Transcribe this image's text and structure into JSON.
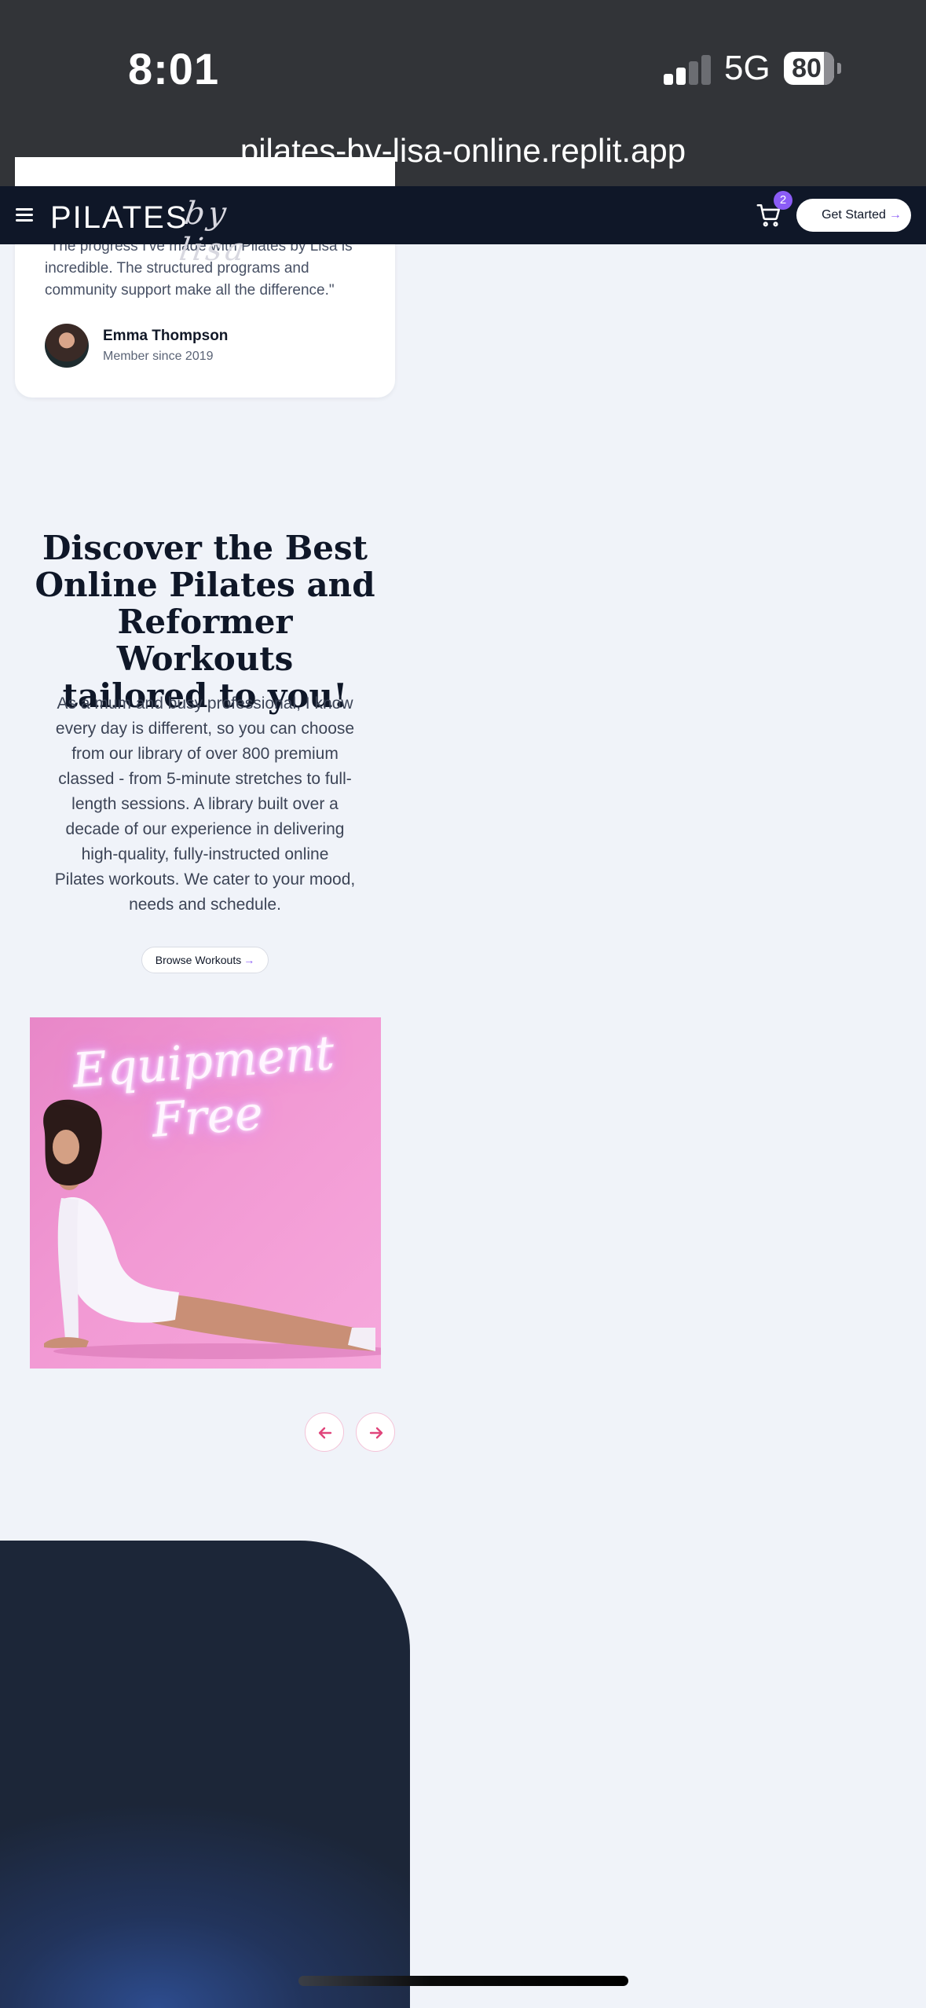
{
  "status_bar": {
    "time": "8:01",
    "network": "5G",
    "battery": "80",
    "url": "pilates-by-lisa-online.replit.app"
  },
  "nav": {
    "logo_main": "PILATES",
    "logo_script": "by lisa",
    "cart_count": "2",
    "cta_label": "Get Started",
    "cta_arrow": "→",
    "menu_icon": "hamburger-icon",
    "cart_icon": "cart-icon",
    "colors": {
      "nav_bg": "#0f1728",
      "accent": "#8b5cf6"
    }
  },
  "testimonial": {
    "quote_lines": [
      "\"The progress I've made with Pilates by Lisa is",
      "incredible. The structured programs and",
      "community support make all the difference.\""
    ],
    "author": "Emma Thompson",
    "since": "Member since 2019"
  },
  "discover": {
    "title_lines": [
      "Discover the Best",
      "Online Pilates and",
      "Reformer Workouts",
      "tailored to you!"
    ],
    "body_lines": [
      "As a mum and busy professional, I know",
      "every day is different, so you can choose",
      "from our library of over 800 premium",
      "classed - from 5-minute stretches to full-",
      "length sessions. A library built over a",
      "decade of our experience in delivering",
      "high-quality, fully-instructed online",
      "Pilates workouts. We cater to your mood,",
      "needs and schedule."
    ],
    "button_label": "Browse Workouts",
    "button_arrow": "→"
  },
  "carousel": {
    "slide_text": "Equipment Free",
    "prev_icon": "arrow-left-icon",
    "next_icon": "arrow-right-icon",
    "colors": {
      "slide_bg": "#f29ad4",
      "arrow": "#e0457b"
    }
  }
}
